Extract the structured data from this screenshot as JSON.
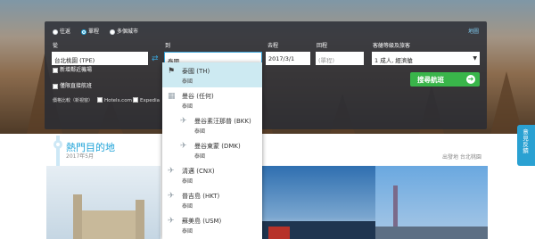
{
  "search": {
    "trip_types": [
      "往返",
      "單程",
      "多個城市"
    ],
    "selected_trip": "單程",
    "map_link": "地圖",
    "from_label": "從",
    "from_value": "台北桃園 (TPE)",
    "to_label": "到",
    "to_value": "泰國",
    "depart_label": "去程",
    "depart_value": "2017/3/1",
    "return_label": "回程",
    "return_placeholder": "(單程)",
    "cabin_label": "客艙等級及旅客",
    "cabin_value": "1 成人, 經濟艙",
    "nearby_airports": "新增鄰近機場",
    "direct_only": "僅限直接航班",
    "compare_label": "價格比較（新視窗）",
    "compare_sites": [
      "Hotels.com",
      "Expedia"
    ],
    "search_button": "搜尋航班",
    "arrow_glyph": "➜",
    "swap_glyph": "⇄"
  },
  "dropdown": {
    "items": [
      {
        "name": "泰國 (TH)",
        "country": "泰國",
        "icon": "flag-icon",
        "selected": true,
        "indent": false
      },
      {
        "name": "曼谷 (任何)",
        "country": "泰國",
        "icon": "city-icon",
        "selected": false,
        "indent": false
      },
      {
        "name": "曼谷素汪那普 (BKK)",
        "country": "泰國",
        "icon": "plane-icon",
        "selected": false,
        "indent": true
      },
      {
        "name": "曼谷東蒙 (DMK)",
        "country": "泰國",
        "icon": "plane-icon",
        "selected": false,
        "indent": true
      },
      {
        "name": "清邁 (CNX)",
        "country": "泰國",
        "icon": "plane-icon",
        "selected": false,
        "indent": false
      },
      {
        "name": "普吉島 (HKT)",
        "country": "泰國",
        "icon": "plane-icon",
        "selected": false,
        "indent": false
      },
      {
        "name": "蘇美島 (USM)",
        "country": "泰國",
        "icon": "plane-icon",
        "selected": false,
        "indent": false
      }
    ]
  },
  "destinations": {
    "title": "熱門目的地",
    "month": "2017年5月",
    "origin_label": "出發地 台北桃園"
  },
  "side_tab": {
    "label": "意見反饋"
  },
  "colors": {
    "accent": "#1fa3d8",
    "search_button": "#39b54a",
    "panel": "#282c34",
    "dropdown_selected": "#cdeaf2"
  }
}
